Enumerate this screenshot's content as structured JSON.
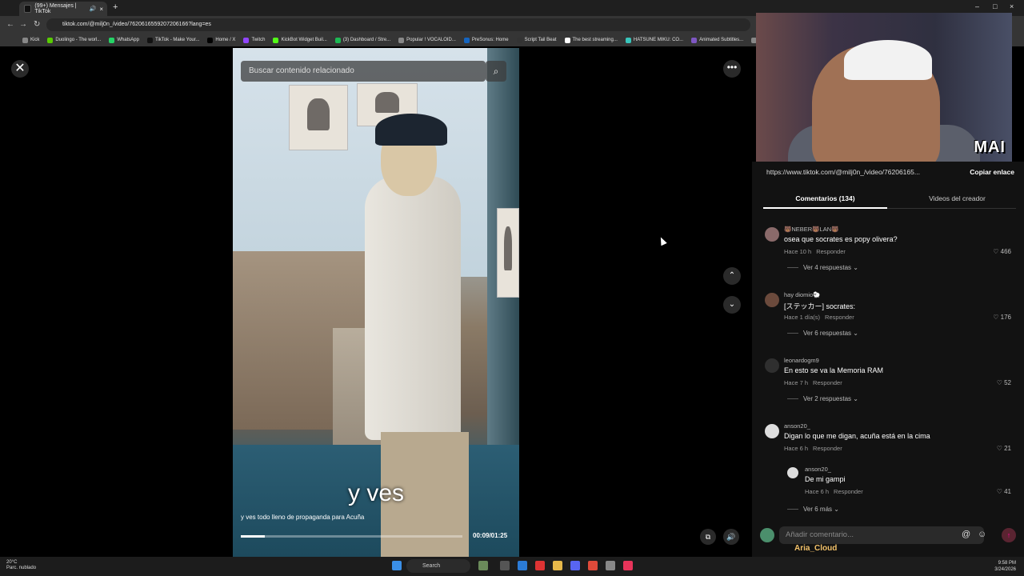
{
  "browser": {
    "tab_title": "(99+) Mensajes | TikTok",
    "url": "tiktok.com/@milj0n_/video/7620616559207206166?lang=es",
    "bookmarks": [
      "Kick",
      "Duolingo - The worl...",
      "WhatsApp",
      "TikTok - Make Your...",
      "Home / X",
      "Twitch",
      "KickBot Widget Buil...",
      "(3) Dashboard / Stre...",
      "Popular ! VOCALOID...",
      "PreSonus: Home",
      "Script Tail Beat",
      "The best streaming...",
      "HATSUNE MIKU: CO...",
      "Animated Subtitles...",
      "HA"
    ]
  },
  "video": {
    "search_placeholder": "Buscar contenido relacionado",
    "overlay_text": "y ves",
    "caption": "y ves todo lleno de propaganda para Acuña",
    "time": "00:09/01:25",
    "progress": 0.11
  },
  "webcam": {
    "watermark": "MAI"
  },
  "panel": {
    "url": "https://www.tiktok.com/@milj0n_/video/76206165...",
    "copy_label": "Copiar enlace",
    "tabs": [
      "Comentarios (134)",
      "Videos del creador"
    ],
    "comments": [
      {
        "user": "🐻NEBER🐻LAN🐻",
        "text": "osea que socrates es popy olivera?",
        "time": "Hace 10 h",
        "reply": "Responder",
        "likes": "466",
        "more": "Ver 4 respuestas ⌄"
      },
      {
        "user": "hay diomio🐑",
        "text": "[ステッカー] socrates:",
        "time": "Hace 1 día(s)",
        "reply": "Responder",
        "likes": "176",
        "more": "Ver 6 respuestas ⌄"
      },
      {
        "user": "leonardogm9",
        "text": "En esto se va la Memoria RAM",
        "time": "Hace 7 h",
        "reply": "Responder",
        "likes": "52",
        "more": "Ver 2 respuestas ⌄"
      },
      {
        "user": "anson20_",
        "text": "Digan lo que me digan, acuña está en la cima",
        "time": "Hace 6 h",
        "reply": "Responder",
        "likes": "21",
        "more": ""
      }
    ],
    "reply": {
      "user": "anson20_",
      "text": "De mi gampi",
      "time": "Hace 6 h",
      "reply": "Responder",
      "likes": "41"
    },
    "more_replies": "Ver 6 más ⌄",
    "input_placeholder": "Añadir comentario...",
    "overlay_name": "Aria_Cloud"
  },
  "taskbar": {
    "weather_temp": "20°C",
    "weather_desc": "Parc. nublado",
    "search": "Search",
    "time": "9:58 PM",
    "date": "3/24/2026"
  }
}
